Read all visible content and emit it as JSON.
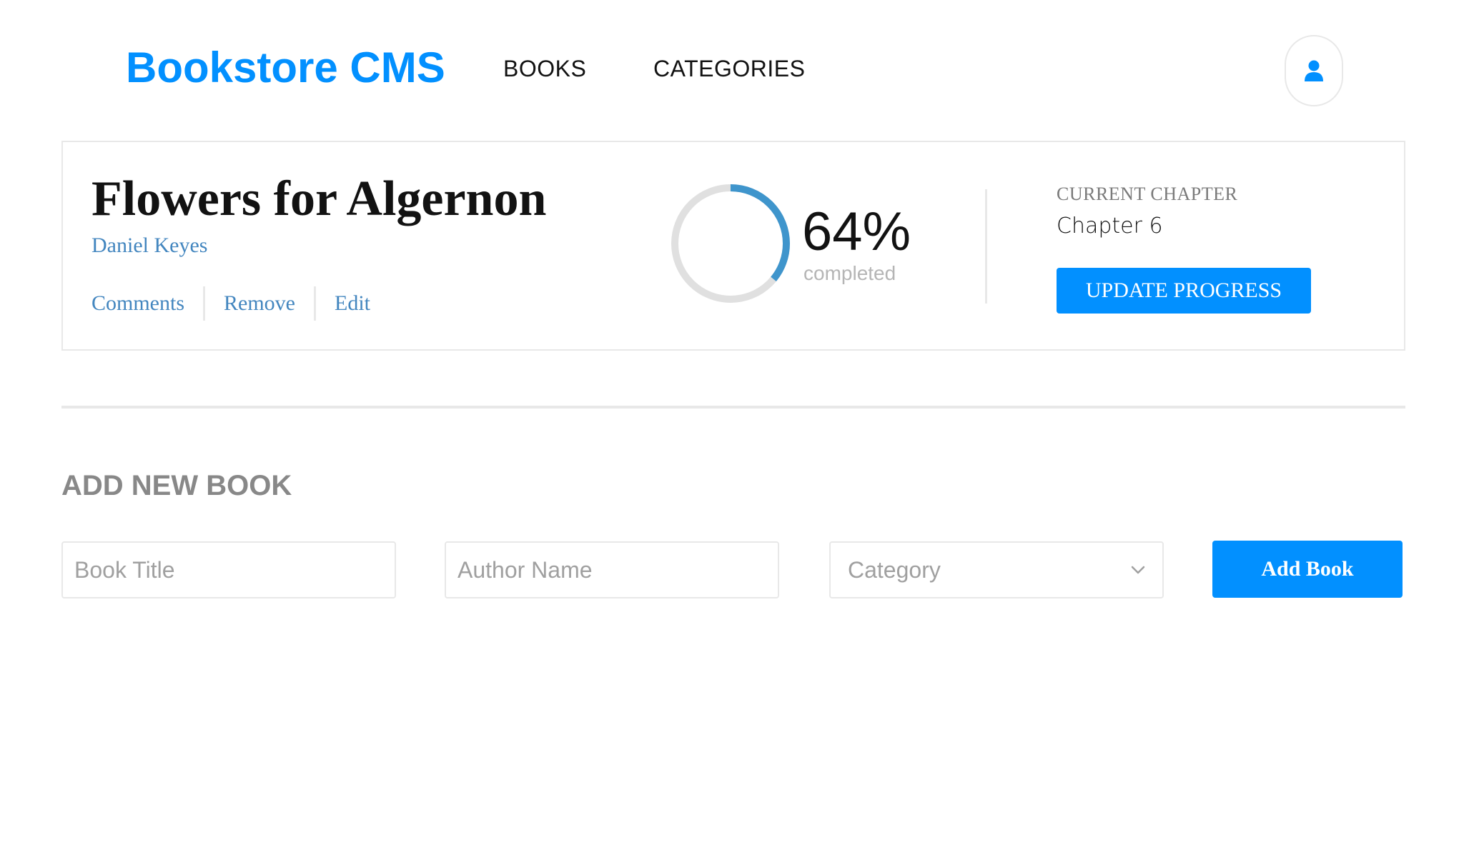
{
  "header": {
    "brand": "Bookstore CMS",
    "nav": [
      {
        "label": "BOOKS"
      },
      {
        "label": "CATEGORIES"
      }
    ],
    "user_icon": "user-icon"
  },
  "book": {
    "title": "Flowers for Algernon",
    "author": "Daniel Keyes",
    "actions": [
      "Comments",
      "Remove",
      "Edit"
    ],
    "progress_percent": 64,
    "progress_text": "64%",
    "completed_label": "completed",
    "current_chapter_label": "CURRENT CHAPTER",
    "current_chapter": "Chapter 6",
    "update_button": "UPDATE PROGRESS"
  },
  "form": {
    "title": "ADD NEW BOOK",
    "title_placeholder": "Book Title",
    "author_placeholder": "Author Name",
    "category_placeholder": "Category",
    "submit": "Add Book"
  },
  "colors": {
    "accent": "#0290ff",
    "link": "#4386bf",
    "ring": "#3f95cc",
    "ring_track": "#e0e0e0",
    "border": "#e8e8e8"
  }
}
